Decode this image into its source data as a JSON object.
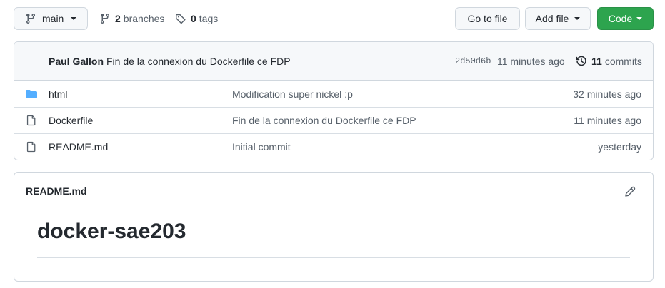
{
  "toolbar": {
    "branch_button": {
      "label": "main",
      "icon": "git-branch-icon"
    },
    "branches": {
      "count": "2",
      "label": "branches",
      "icon": "git-branch-icon"
    },
    "tags": {
      "count": "0",
      "label": "tags",
      "icon": "tag-icon"
    },
    "goto_file_label": "Go to file",
    "add_file_label": "Add file",
    "code_label": "Code"
  },
  "latest_commit": {
    "author": "Paul Gallon",
    "message": "Fin de la connexion du Dockerfile ce FDP",
    "sha": "2d50d6b",
    "age": "11 minutes ago",
    "commit_count": "11",
    "commit_label": "commits",
    "icon": "history-icon"
  },
  "files": [
    {
      "type": "directory",
      "icon": "folder-icon",
      "name": "html",
      "message": "Modification super nickel :p",
      "age": "32 minutes ago"
    },
    {
      "type": "file",
      "icon": "file-icon",
      "name": "Dockerfile",
      "message": "Fin de la connexion du Dockerfile ce FDP",
      "age": "11 minutes ago"
    },
    {
      "type": "file",
      "icon": "file-icon",
      "name": "README.md",
      "message": "Initial commit",
      "age": "yesterday"
    }
  ],
  "readme": {
    "filename": "README.md",
    "heading": "docker-sae203",
    "edit_icon": "pencil-icon"
  },
  "colors": {
    "accent_green": "#2da44e",
    "folder_blue": "#54aeff",
    "text_muted": "#57606a",
    "border": "#d0d7de"
  }
}
